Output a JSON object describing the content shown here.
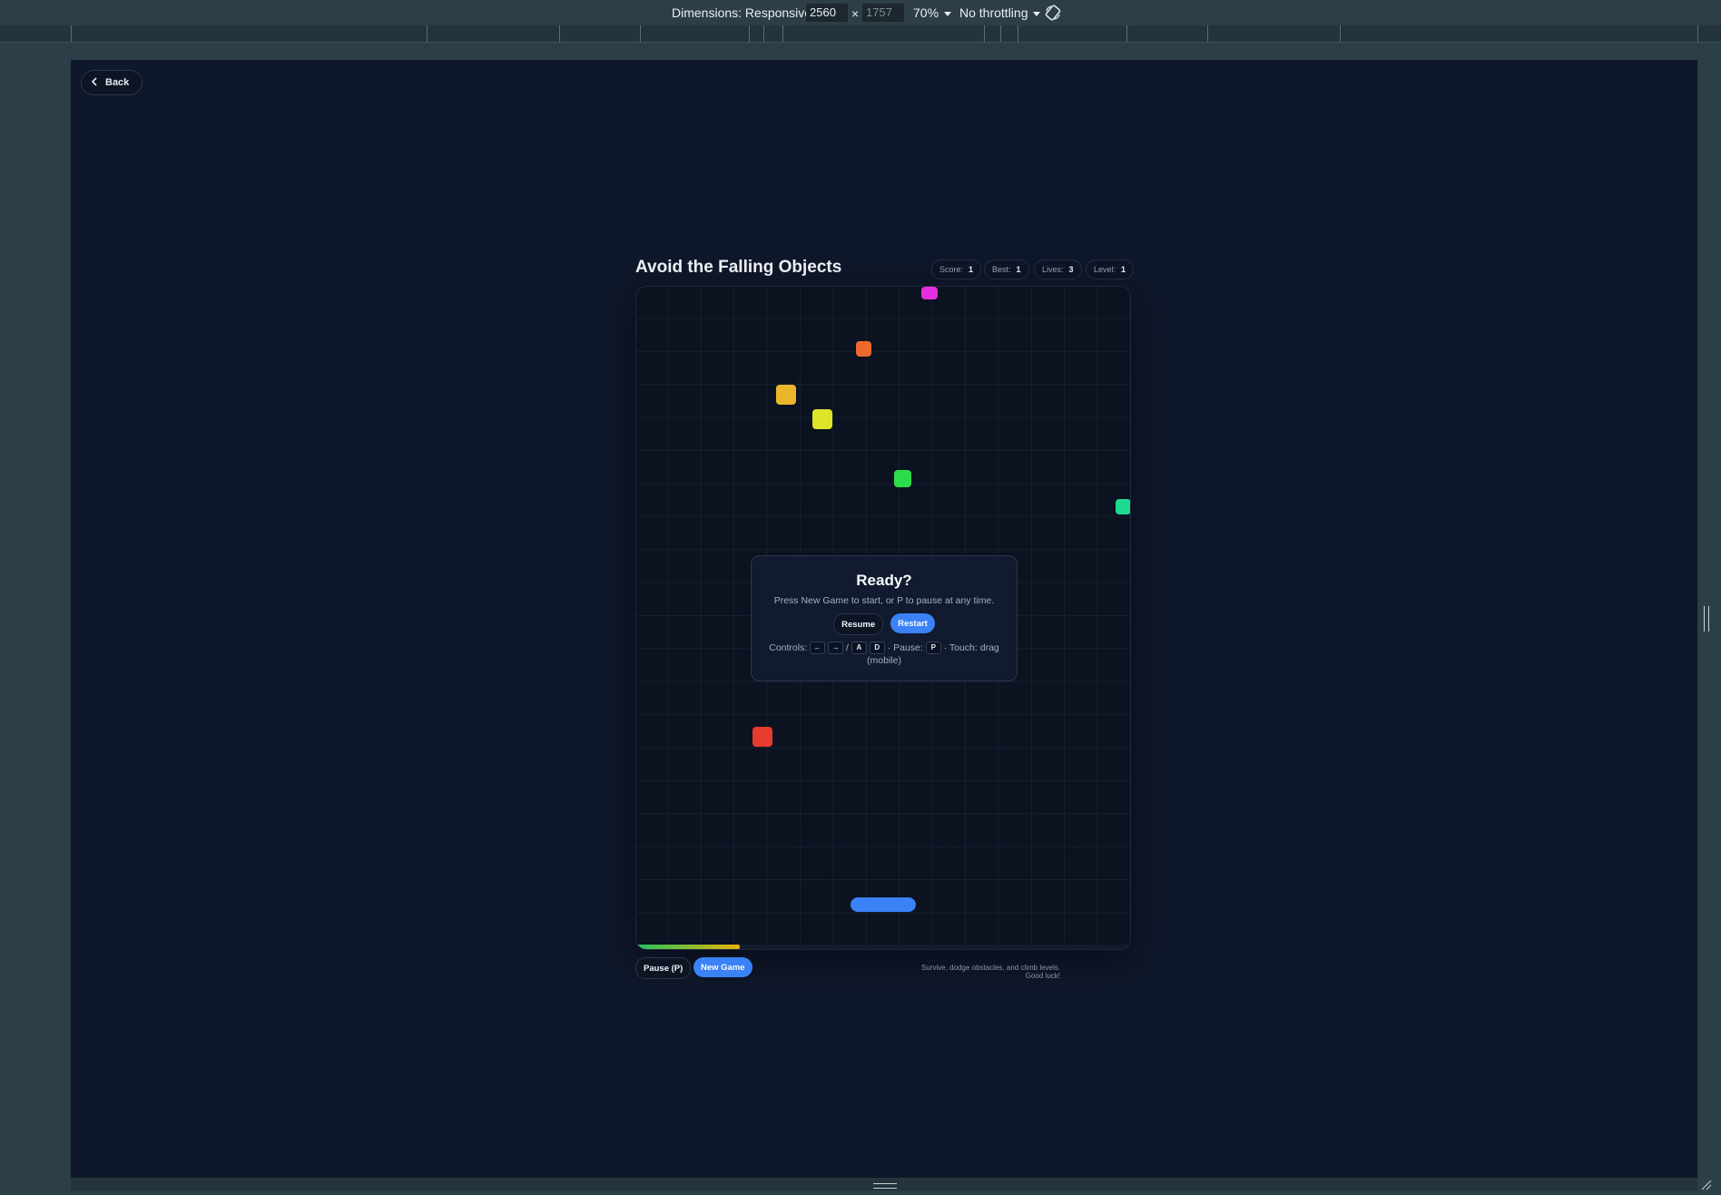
{
  "devtools": {
    "dimensions_label": "Dimensions: Responsive",
    "width_value": "2560",
    "times": "×",
    "height_value": "1757",
    "zoom": "70%",
    "throttling": "No throttling",
    "rotate_icon": "rotate-icon"
  },
  "page": {
    "back_label": "Back",
    "title": "Avoid the Falling Objects",
    "stats": [
      {
        "label": "Score:",
        "value": "1"
      },
      {
        "label": "Best:",
        "value": "1"
      },
      {
        "label": "Lives:",
        "value": "3"
      },
      {
        "label": "Level:",
        "value": "1"
      }
    ],
    "overlay": {
      "title": "Ready?",
      "message": "Press New Game to start, or P to pause at any time.",
      "resume_label": "Resume",
      "restart_label": "Restart",
      "controls_prefix": "Controls:",
      "key_left": "←",
      "key_right": "→",
      "slash": "/",
      "key_a": "A",
      "key_d": "D",
      "pause_text": "· Pause:",
      "key_p": "P",
      "touch_text": "· Touch: drag (mobile)"
    },
    "pause_button_label": "Pause (P)",
    "new_game_label": "New Game",
    "footnote": "Survive, dodge obstacles, and climb levels. Good luck!",
    "level_progress": 0.21
  },
  "colors": {
    "background": "#0f172a",
    "accent": "#3b82f6",
    "objects": [
      "#e62fe0",
      "#ec6a2c",
      "#eab72a",
      "#dde52a",
      "#2ddc4a",
      "#1fd991",
      "#e63b2e"
    ]
  }
}
